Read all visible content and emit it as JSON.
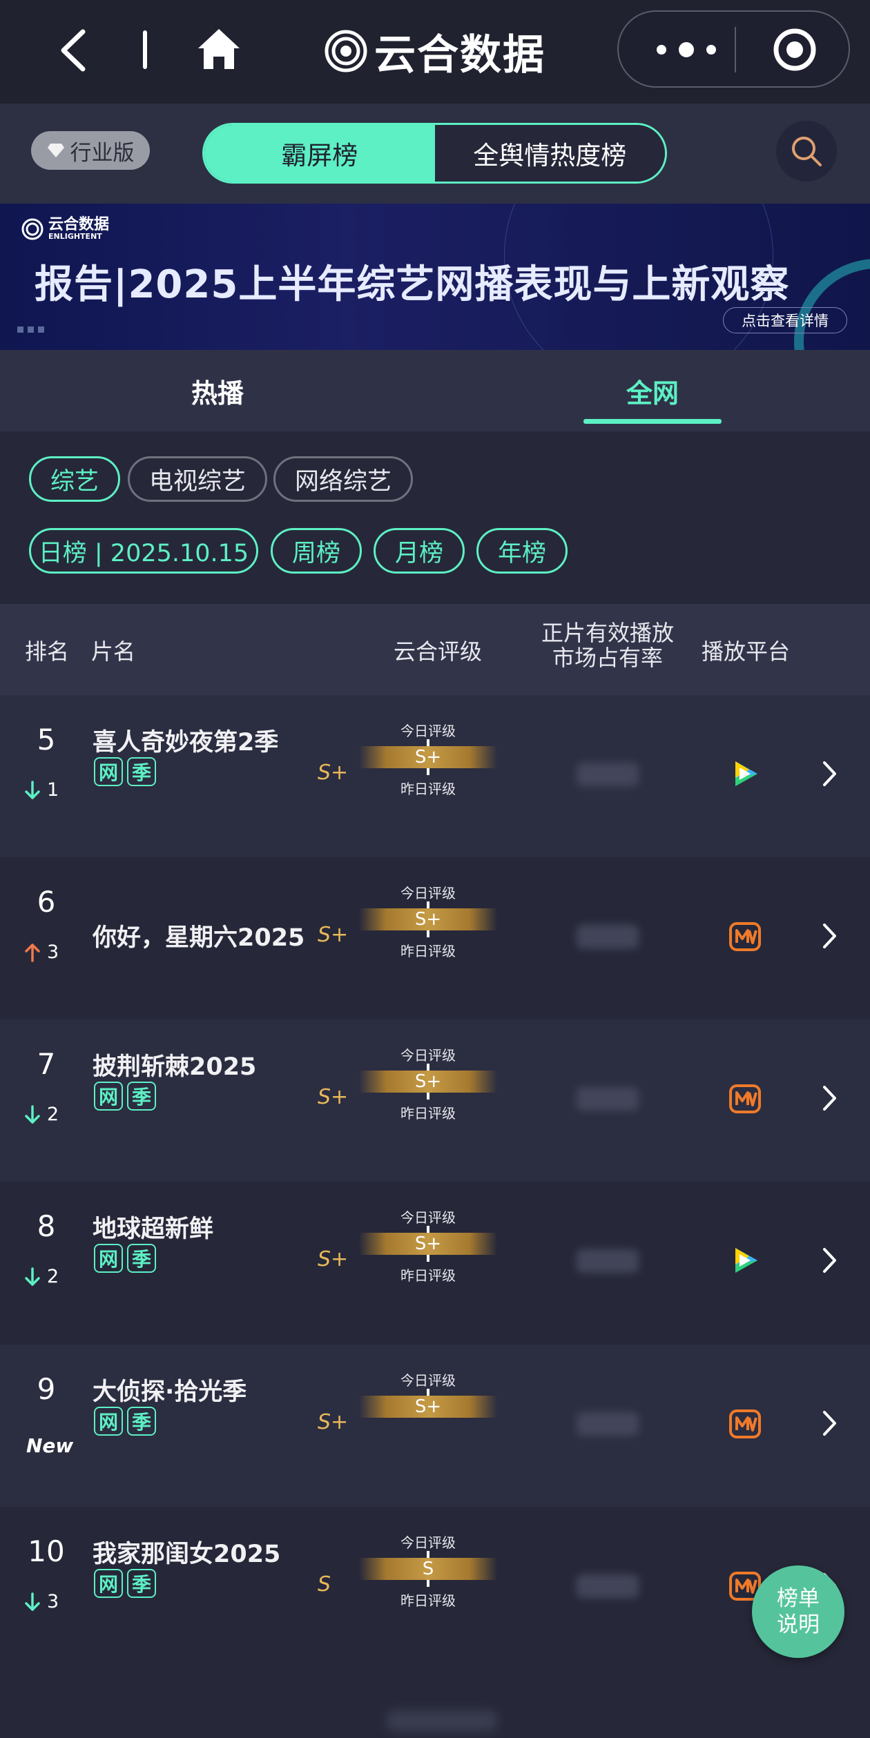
{
  "app": {
    "title": "云合数据",
    "icons": {
      "back": "chevron-left-icon",
      "home": "home-icon",
      "more": "more-dots-icon",
      "record": "record-circle-icon"
    }
  },
  "switchbar": {
    "industry_label": "行业版",
    "segments": [
      {
        "label": "霸屏榜",
        "active": true
      },
      {
        "label": "全舆情热度榜",
        "active": false
      }
    ],
    "search_icon": "search-icon"
  },
  "banner": {
    "logo_cn": "云合数据",
    "logo_en": "ENLIGHTENT",
    "title": "报告|2025上半年综艺网播表现与上新观察",
    "cta": "点击查看详情"
  },
  "tabs": [
    {
      "label": "热播",
      "active": false
    },
    {
      "label": "全网",
      "active": true
    }
  ],
  "filters": {
    "categories": [
      {
        "label": "综艺",
        "active": true
      },
      {
        "label": "电视综艺",
        "active": false
      },
      {
        "label": "网络综艺",
        "active": false
      }
    ],
    "periods": [
      {
        "label": "日榜 | 2025.10.15",
        "active": true
      },
      {
        "label": "周榜",
        "active": true
      },
      {
        "label": "月榜",
        "active": true
      },
      {
        "label": "年榜",
        "active": true
      }
    ]
  },
  "table": {
    "headers": {
      "rank": "排名",
      "name": "片名",
      "rating": "云合评级",
      "share_line1": "正片有效播放",
      "share_line2": "市场占有率",
      "platform": "播放平台"
    },
    "today_label": "今日评级",
    "yesterday_label": "昨日评级",
    "rows": [
      {
        "rank": "5",
        "change_dir": "down",
        "change": "1",
        "title": "喜人奇妙夜第2季",
        "tags": [
          "网",
          "季"
        ],
        "grade_yesterday": "S+",
        "grade_today": "S+",
        "platform": "tencent-video-icon",
        "show_yesterday": true
      },
      {
        "rank": "6",
        "change_dir": "up",
        "change": "3",
        "title": "你好，星期六2025",
        "tags": [],
        "grade_yesterday": "S+",
        "grade_today": "S+",
        "platform": "mango-tv-icon",
        "show_yesterday": true
      },
      {
        "rank": "7",
        "change_dir": "down",
        "change": "2",
        "title": "披荆斩棘2025",
        "tags": [
          "网",
          "季"
        ],
        "grade_yesterday": "S+",
        "grade_today": "S+",
        "platform": "mango-tv-icon",
        "show_yesterday": true
      },
      {
        "rank": "8",
        "change_dir": "down",
        "change": "2",
        "title": "地球超新鲜",
        "tags": [
          "网",
          "季"
        ],
        "grade_yesterday": "S+",
        "grade_today": "S+",
        "platform": "tencent-video-icon",
        "show_yesterday": true
      },
      {
        "rank": "9",
        "change_dir": "new",
        "change": "New",
        "title": "大侦探·拾光季",
        "tags": [
          "网",
          "季"
        ],
        "grade_yesterday": "S+",
        "grade_today": "S+",
        "platform": "mango-tv-icon",
        "show_yesterday": false
      },
      {
        "rank": "10",
        "change_dir": "down",
        "change": "3",
        "title": "我家那闺女2025",
        "tags": [
          "网",
          "季"
        ],
        "grade_yesterday": "S",
        "grade_today": "S",
        "platform": "mango-tv-icon",
        "show_yesterday": true
      }
    ]
  },
  "fab": {
    "line1": "榜单",
    "line2": "说明"
  },
  "colors": {
    "accent": "#5df0c4",
    "gold": "#e8b85a",
    "up": "#f07a4a",
    "down": "#5df0c4",
    "mango": "#f07a2a"
  }
}
